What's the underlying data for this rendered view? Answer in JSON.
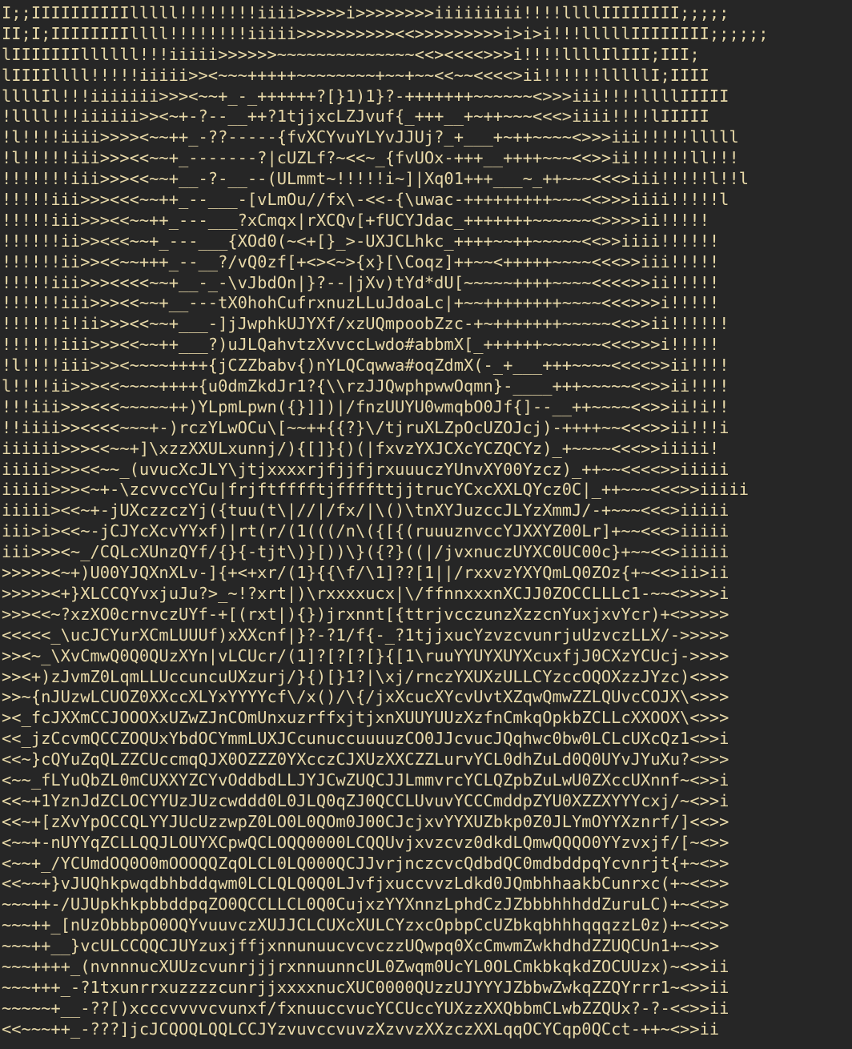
{
  "text_color": "#e8d9a8",
  "background_color": "#262626",
  "lines": [
    "I;;IIIIIIIIIIlllll!!!!!!!!iiii>>>>>i>>>>>>>>iiiiiiiii!!!!llllIIIIIIII;;;;;",
    "II;I;IIIIIIIIllll!!!!!!!!iiiii>>>>>>>>>><<>>>>>>>>>i>i>i!!!lllllIIIIIIII;;;;;;",
    "lIIIIIIIllllll!!!iiiii>>>>>>~~~~~~~~~~~~~~<<><<<<>>>i!!!!llllIlIII;III;",
    "lIIIIllll!!!!!iiiii>><~~~+++++~~~~~~~~+~~+~~<<~~<<<<>ii!!!!!!lllllI;IIII",
    "llllIl!!!iiiiiii>>><~~+_-_++++++?[}1)1}?-+++++++~~~~~~<>>>iii!!!!llllIIIII",
    "!llll!!!iiiiii>><~+-?--__++?1tjjxcLZJvuf{_+++__+~++~~~<<<>iiii!!!!lIIIII",
    "!l!!!!iiii>>>><~~++_-??-----{fvXCYvuYLYvJJUj?_+___+~++~~~~<>>>iii!!!!!lllll",
    "!l!!!!!iii>>><<~~+_-------?|cUZLf?~<<~_{fvUOx-+++__++++~~~<<>>ii!!!!!!ll!!!",
    "!!!!!!!iii>>><<~~+__-?-__--(ULmmt~!!!!!i~]|Xq01+++___~_++~~~<<<>iii!!!!!l!!l",
    "!!!!!iii>>><<<~~++_--___-[vLmOu//fx\\-<<-{\\uwac-+++++++++~~~<<>>>iiii!!!!!l",
    "!!!!!iii>>><<~~++_---___?xCmqx|rXCQv[+fUCYJdac_+++++++~~~~~~<>>>>ii!!!!!",
    "!!!!!!ii>><<<~~+_---___{XOd0(~<+[}_>-UXJCLhkc_++++~~++~~~~~<<>>iiii!!!!!!",
    "!!!!!!ii>><<~~+++_--__?/vQ0zf[+<><~>{x}[\\Coqz]++~~<+++++~~~~<<<>>iii!!!!!",
    "!!!!!iii>>><<<<~~+__-_-\\vJbdOn|}?--|jXv)tYd*dU[~~~~~++++~~~~<<<<>>ii!!!!!",
    "!!!!!!iii>>><<~~+__---tX0hohCufrxnuzLLuJdoaLc|+~~++++++++~~~~<<<>>>i!!!!!",
    "!!!!!!i!ii>>><<~~+___-]jJwphkUJYXf/xzUQmpoobZzc-+~+++++++~~~~~<<>>ii!!!!!!",
    "!!!!!!iii>>><<~~++___?)uJLQahvtzXvvccLwdo#abbmX[_++++++~~~~~~<<<>>>i!!!!!",
    "!l!!!!iii>>><~~~~++++{jCZZbabv{)nYLQCqwwa#oqZdmX(-_+___+++~~~~<<<<>>ii!!!!",
    "l!!!!ii>>><<~~~~++++{u0dmZkdJr1?{\\\\rzJJQwphpwwOqmn}-____+++~~~~~<<>>ii!!!!",
    "!!!iii>>><<<~~~~~++)YLpmLpwn({}]])|/fnzUUYU0wmqbO0Jf{]--__++~~~~<<>>ii!i!!",
    "!!iiii>><<<<~~~+-)rczYLwOCu\\[~~++{{?}\\/tjruXLZpOcUZOJcj)-++++~~<<<>>ii!!!i",
    "iiiiii>>><<~~+]\\xzzXXULxunnj/){[]}{)(|fxvzYXJCXcYCZQCYz)_+~~~~<<<>>iiiii!",
    "iiiii>>><<~~_(uvucXcJLY\\jtjxxxxrjfjjfjrxuuuczYUnvXY00Yzcz)_++~~<<<<>>iiiii",
    "iiiii>>><~+-\\zcvvccYCu|frjftfffftjffffttjjtrucYCxcXXLQYcz0C|_++~~~<<<>>iiiii",
    "iiiii><<~+-jUXczzczYj({tuu(t\\|//|/fx/|\\()\\tnXYJuzccJLYzXmmJ/-+~~~<<<>iiiii",
    "iii>i><<~-jCJYcXcvYYxf)|rt(r/(1(((/n\\({[{(ruuuznvccYJXXYZ00Lr]+~~<<<>iiiii",
    "iii>>><~_/CQLcXUnzQYf/{}{-tjt\\)}[))\\}({?}((|/jvxnuczUYXC0UC00c}+~~<<>iiiii",
    ">>>>><~+)U00YJQXnXLv-]{+<+xr/(1}{{\\f/\\1]??[1||/rxxvzYXYQmLQ0ZOz{+~<<>ii>ii",
    ">>>>><+}XLCCQYvxjuJu?>_~!?xrt|)\\rxxxxucx|\\/ffnnxxxnXCJJ0ZOCCLLLc1-~~<>>>>i",
    ">>><<~?xzXO0crnvczUYf-+[(rxt|){})jrxnnt[{ttrjvcczunzXzzcnYuxjxvYcr)+<>>>>>",
    "<<<<<_\\ucJCYurXCmLUUUf)xXXcnf|}?-?1/f{-_?1tjjxucYzvzcvunrjuUzvczLLX/->>>>>",
    ">><~_\\XvCmwQ0Q0QUzXYn|vLCUcr/(1]?[?[?[}{[1\\ruuYYUYXUYXcuxfjJ0CXzYCUcj->>>>",
    ">><+)zJvmZ0LqmLLUccuncuUXzurj/}{)[}1?|\\xj/rnczYXUXzULLCYzccOQOXzzJYzc)<>>>",
    ">>~{nJUzwLCUOZ0XXccXLYxYYYYcf\\/x()/\\{/jxXcucXYcvUvtXZqwQmwZZLQUvcCOJX\\<>>>",
    "><_fcJXXmCCJOOOXxUZwZJnCOmUnxuzrffxjtjxnXUUYUUzXzfnCmkqOpkbZCLLcXXOOX\\<>>>",
    "<<_jzCcvmQCCZOQUxYbdOCYmmLUXJCcunuccuuuuzCO0JJcvucJQqhwc0bw0LCLcUXcQz1<>>i",
    "<<~}cQYuZqQLZZCUccmqQJX0OZZZ0YXcczCJXUzXXCZZLurvYCL0dhZuLd0Q0UYvJYuXu?<>>>",
    "<~~_fLYuQbZL0mCUXXYZCYvOddbdLLJYJCwZUQCJJLmmvrcYCLQZpbZuLwU0ZXccUXnnf~<>>i",
    "<<~+1YznJdZCLOCYYUzJUzcwddd0L0JLQ0qZJ0QCCLUvuvYCCCmddpZYU0XZZXYYYcxj/~<>>i",
    "<<~+[zXvYpOCCQLYYJUcUzzwpZ0LO0L0QOm0J00CJcjxvYYXUZbkp0Z0JLYmOYYXznrf/]<<>>",
    "<~~+-nUYYqZCLLQQJLOUYXCpwQCLOQQ0000LCQQUvjxvzcvz0dkdLQmwQQQO0YYzvxjf/[~<>>",
    "<~~+_/YCUmdOQ0O0mOOOQQZqOLCL0LQ000QCJJvrjnczcvcQdbdQC0mdbddpqYcvnrjt{+~<>>",
    "<<~~+}vJUQhkpwqdbhbddqwm0LCLQLQ0Q0LJvfjxuccvvzLdkd0JQmbhhaakbCunrxc(+~<<>>",
    "~~~++-/UJUpkhkpbbddpqZO0QCCLLCL0Q0CujxzYYXnnzLphdCzJZbbbhhhddZuruLC)+~<<>>",
    "~~~++_[nUzObbbpO0OQYvuuvczXUJJCLCUXcXULCYzxcOpbpCcUZbkqbhhhqqqzzL0z)+~<<>>",
    "~~~++__}vcULCCQQCJUYzuxjffjxnnunuucvcvczzUQwpq0XcCmwmZwkhdhdZZUQCUn1+~<>>",
    "~~~++++_(nvnnnucXUUzcvunrjjjrxnnuunncUL0Zwqm0UcYL0OLCmkbkqkdZOCUUzx)~<>>ii",
    "~~~+++_-?1txunrrxuzzzzcunrjjxxxxnucXUC0000QUzzUJYYYJZbbwZwkqZZQYrrr1~<>>ii",
    "~~~~~+__-??[)xcccvvvvcvunxf/fxnuuccvucYCCUccYUXzzXXQbbmCLwbZZQUx?-?-<<>>ii",
    "<<~~~++_-???]jcJCQOQLQQLCCJYzvuvccvuvzXzvvzXXzczXXLqqOCYCqp0QCct-++~<>>ii"
  ]
}
